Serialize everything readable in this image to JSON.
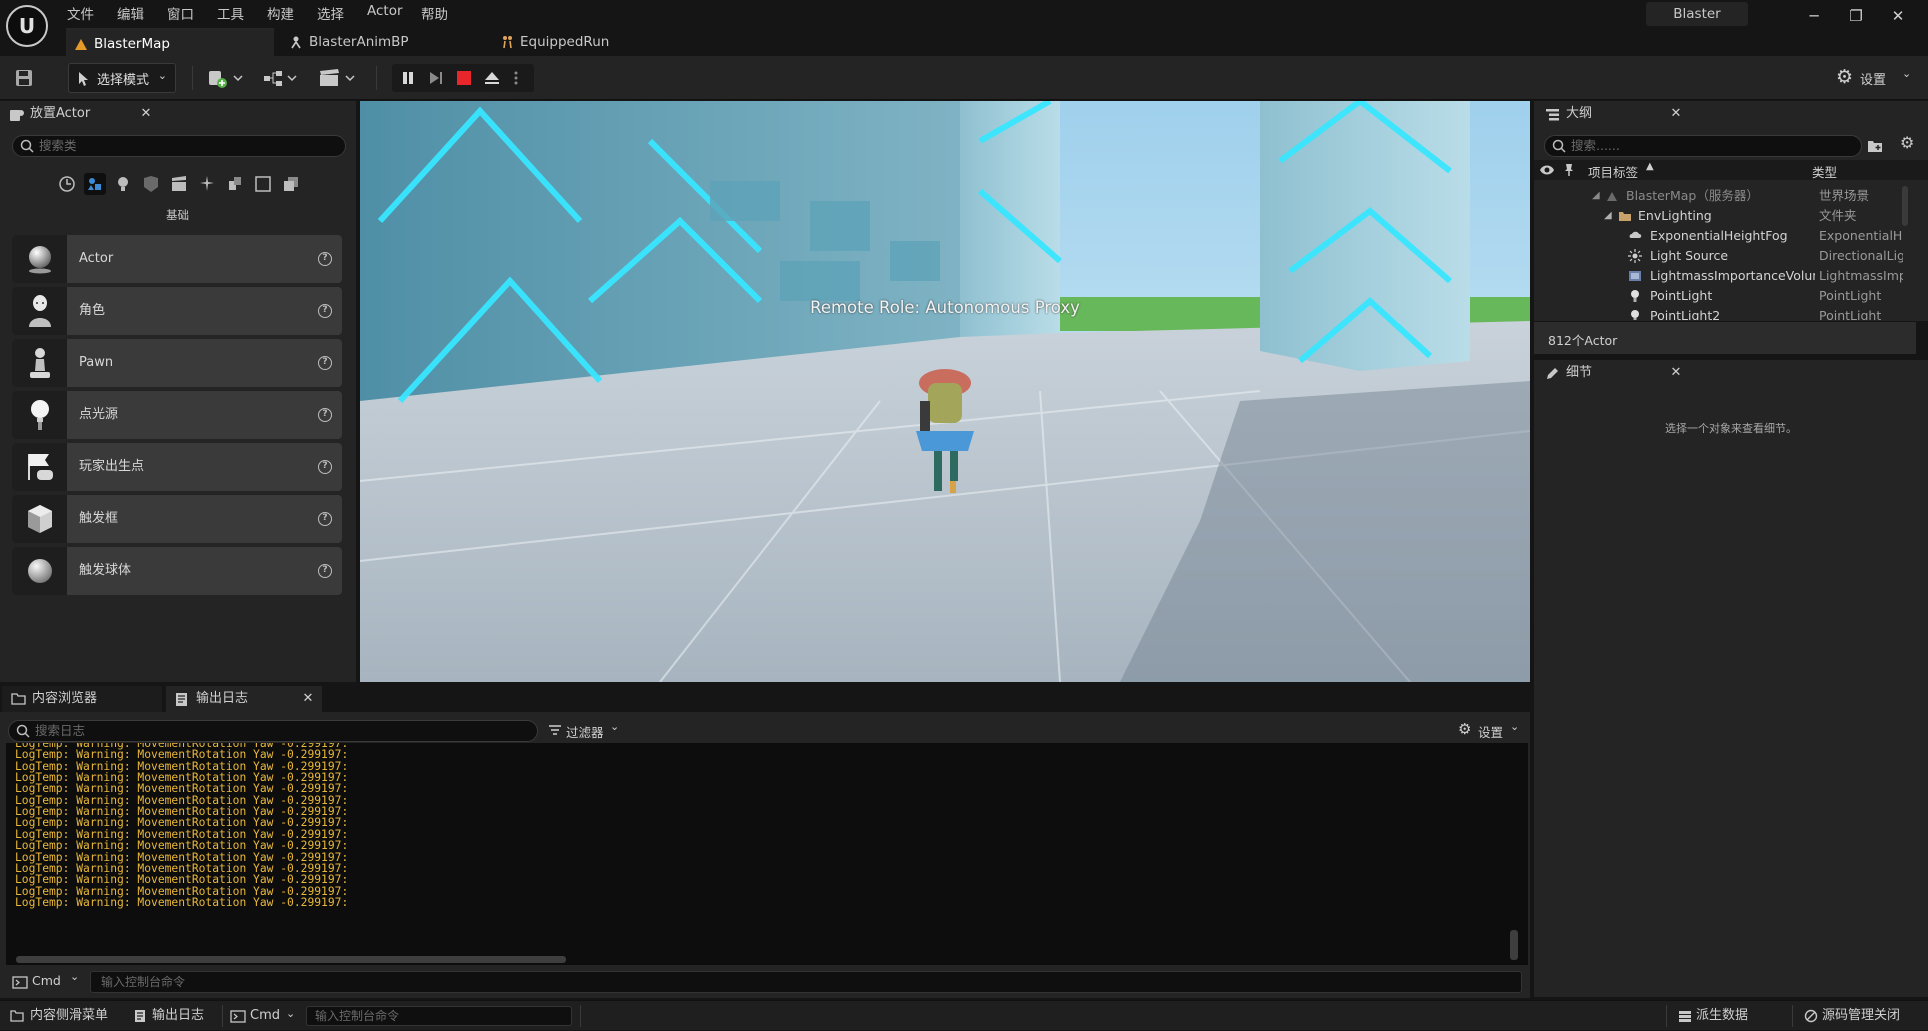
{
  "menu": [
    "文件",
    "编辑",
    "窗口",
    "工具",
    "构建",
    "选择",
    "Actor",
    "帮助"
  ],
  "project_name": "Blaster",
  "doc_tabs": [
    {
      "label": "BlasterMap",
      "active": true
    },
    {
      "label": "BlasterAnimBP",
      "active": false
    },
    {
      "label": "EquippedRun",
      "active": false
    }
  ],
  "toolbar": {
    "mode_label": "选择模式",
    "settings_label": "设置"
  },
  "place_actors": {
    "tab_label": "放置Actor",
    "search_placeholder": "搜索类",
    "category_label": "基础",
    "items": [
      {
        "label": "Actor",
        "icon": "sphere-icon"
      },
      {
        "label": "角色",
        "icon": "character-icon"
      },
      {
        "label": "Pawn",
        "icon": "pawn-icon"
      },
      {
        "label": "点光源",
        "icon": "point-light-icon"
      },
      {
        "label": "玩家出生点",
        "icon": "player-start-icon"
      },
      {
        "label": "触发框",
        "icon": "trigger-box-icon"
      },
      {
        "label": "触发球体",
        "icon": "trigger-sphere-icon"
      }
    ]
  },
  "viewport": {
    "overlay_text": "Remote Role: Autonomous Proxy"
  },
  "outliner": {
    "tab_label": "大纲",
    "search_placeholder": "搜索......",
    "col_label": "项目标签",
    "col_type": "类型",
    "rows": [
      {
        "label": "BlasterMap（服务器）",
        "type": "世界场景",
        "indent": 0,
        "dim": true
      },
      {
        "label": "EnvLighting",
        "type": "文件夹",
        "indent": 1,
        "dim": false
      },
      {
        "label": "ExponentialHeightFog",
        "type": "ExponentialHe",
        "indent": 2,
        "dim": false
      },
      {
        "label": "Light Source",
        "type": "DirectionalLigl",
        "indent": 2,
        "dim": false
      },
      {
        "label": "LightmassImportanceVolum",
        "type": "LightmassImp",
        "indent": 2,
        "dim": false
      },
      {
        "label": "PointLight",
        "type": "PointLight",
        "indent": 2,
        "dim": false
      },
      {
        "label": "PointLight2",
        "type": "PointLight",
        "indent": 2,
        "dim": false
      }
    ],
    "actor_count": "812个Actor"
  },
  "details": {
    "tab_label": "细节",
    "empty_message": "选择一个对象来查看细节。"
  },
  "bottom_tabs": {
    "content_browser": "内容浏览器",
    "output_log": "输出日志"
  },
  "log": {
    "search_placeholder": "搜索日志",
    "filter_label": "过滤器",
    "settings_label": "设置",
    "lines": [
      "LogTemp: Warning: MovementRotation Yaw -0.299197:",
      "LogTemp: Warning: MovementRotation Yaw -0.299197:",
      "LogTemp: Warning: MovementRotation Yaw -0.299197:",
      "LogTemp: Warning: MovementRotation Yaw -0.299197:",
      "LogTemp: Warning: MovementRotation Yaw -0.299197:",
      "LogTemp: Warning: MovementRotation Yaw -0.299197:",
      "LogTemp: Warning: MovementRotation Yaw -0.299197:",
      "LogTemp: Warning: MovementRotation Yaw -0.299197:",
      "LogTemp: Warning: MovementRotation Yaw -0.299197:",
      "LogTemp: Warning: MovementRotation Yaw -0.299197:",
      "LogTemp: Warning: MovementRotation Yaw -0.299197:",
      "LogTemp: Warning: MovementRotation Yaw -0.299197:",
      "LogTemp: Warning: MovementRotation Yaw -0.299197:",
      "LogTemp: Warning: MovementRotation Yaw -0.299197:",
      "LogTemp: Warning: MovementRotation Yaw -0.299197:"
    ],
    "cmd_label": "Cmd",
    "cmd_placeholder": "输入控制台命令"
  },
  "statusbar": {
    "content_drawer": "内容侧滑菜单",
    "output_log": "输出日志",
    "cmd_label": "Cmd",
    "cmd_placeholder": "输入控制台命令",
    "derived_data": "派生数据",
    "source_control": "源码管理关闭"
  }
}
